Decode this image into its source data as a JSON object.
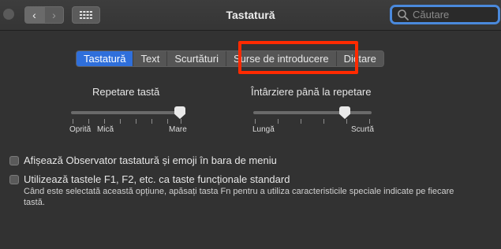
{
  "window": {
    "title": "Tastatură"
  },
  "search": {
    "placeholder": "Căutare"
  },
  "tabs": [
    {
      "label": "Tastatură",
      "selected": true
    },
    {
      "label": "Text",
      "selected": false
    },
    {
      "label": "Scurtături",
      "selected": false
    },
    {
      "label": "Surse de introducere",
      "selected": false
    },
    {
      "label": "Dictare",
      "selected": false
    }
  ],
  "key_repeat": {
    "title": "Repetare tastă",
    "labels": {
      "off": "Oprită",
      "slow": "Mică",
      "fast": "Mare"
    },
    "value_fraction": 1.0
  },
  "repeat_delay": {
    "title": "Întârziere până la repetare",
    "labels": {
      "long": "Lungă",
      "short": "Scurtă"
    },
    "value_fraction": 0.8
  },
  "options": {
    "show_viewer": {
      "label": "Afișează Observator tastatură și emoji în bara de meniu",
      "checked": false
    },
    "fn_keys": {
      "label": "Utilizează tastele F1, F2, etc. ca taste funcționale standard",
      "checked": false,
      "help": "Când este selectată această opțiune, apăsați tasta Fn pentru a utiliza caracteristicile speciale indicate pe fiecare tastă."
    }
  },
  "colors": {
    "accent": "#2f6fdb",
    "highlight": "#ff2a00",
    "background": "#323232"
  }
}
